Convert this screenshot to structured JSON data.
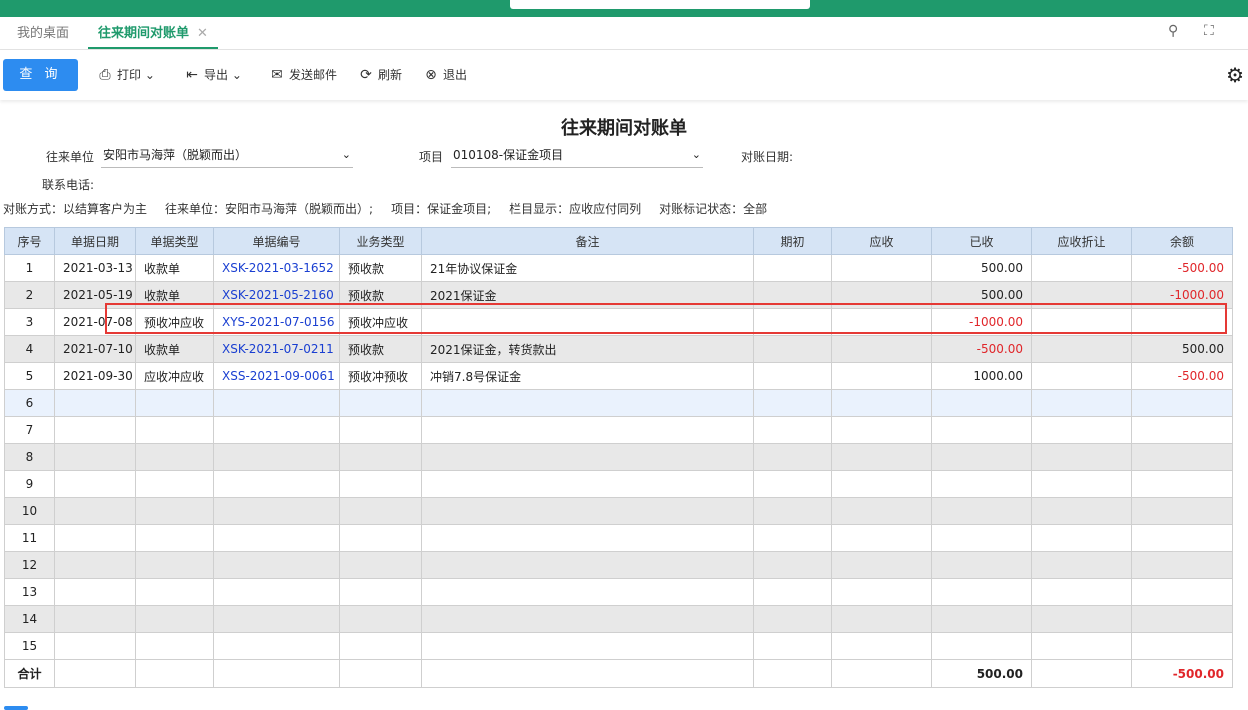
{
  "topbar": {
    "brand": "",
    "bracket": "",
    "paren": "",
    "icons": [
      "file-icon",
      "list-icon",
      "send-icon",
      "bell-icon",
      "user-icon",
      "more-icon"
    ]
  },
  "tabs": [
    {
      "label": "我的桌面"
    },
    {
      "label": "往来期间对账单",
      "close": "✕"
    }
  ],
  "toolbar": {
    "query": "查 询",
    "print": "打印",
    "export": "导出",
    "email": "发送邮件",
    "refresh": "刷新",
    "exit": "退出"
  },
  "report": {
    "title": "往来期间对账单",
    "unit_label": "往来单位",
    "unit_value": "安阳市马海萍（脱颖而出）",
    "project_label": "项目",
    "project_value": "010108-保证金项目",
    "date_label": "对账日期:",
    "phone_label": "联系电话:",
    "info": [
      "对账方式：以结算客户为主",
      "往来单位：安阳市马海萍（脱颖而出）;",
      "项目：保证金项目;",
      "栏目显示：应收应付同列",
      "对账标记状态：全部"
    ]
  },
  "table": {
    "headers": [
      "序号",
      "单据日期",
      "单据类型",
      "单据编号",
      "业务类型",
      "备注",
      "期初",
      "应收",
      "已收",
      "应收折让",
      "余额"
    ],
    "rows": [
      {
        "no": "1",
        "date": "2021-03-13",
        "type": "收款单",
        "code": "XSK-2021-03-1652",
        "biz": "预收款",
        "note": "21年协议保证金",
        "qc": "",
        "ys": "",
        "yis": "500.00",
        "zr": "",
        "ye": "-500.00"
      },
      {
        "no": "2",
        "date": "2021-05-19",
        "type": "收款单",
        "code": "XSK-2021-05-2160",
        "biz": "预收款",
        "note": "2021保证金",
        "qc": "",
        "ys": "",
        "yis": "500.00",
        "zr": "",
        "ye": "-1000.00"
      },
      {
        "no": "3",
        "date": "2021-07-08",
        "type": "预收冲应收",
        "code": "XYS-2021-07-0156",
        "biz": "预收冲应收",
        "note": "",
        "qc": "",
        "ys": "",
        "yis": "-1000.00",
        "zr": "",
        "ye": ""
      },
      {
        "no": "4",
        "date": "2021-07-10",
        "type": "收款单",
        "code": "XSK-2021-07-0211",
        "biz": "预收款",
        "note": "2021保证金，转货款出",
        "qc": "",
        "ys": "",
        "yis": "-500.00",
        "zr": "",
        "ye": "500.00"
      },
      {
        "no": "5",
        "date": "2021-09-30",
        "type": "应收冲应收",
        "code": "XSS-2021-09-0061",
        "biz": "预收冲预收",
        "note": "冲销7.8号保证金",
        "qc": "",
        "ys": "",
        "yis": "1000.00",
        "zr": "",
        "ye": "-500.00"
      },
      {
        "no": "6"
      },
      {
        "no": "7"
      },
      {
        "no": "8"
      },
      {
        "no": "9"
      },
      {
        "no": "10"
      },
      {
        "no": "11"
      },
      {
        "no": "12"
      },
      {
        "no": "13"
      },
      {
        "no": "14"
      },
      {
        "no": "15"
      }
    ],
    "total": {
      "label": "合计",
      "yis": "500.00",
      "ye": "-500.00"
    }
  }
}
